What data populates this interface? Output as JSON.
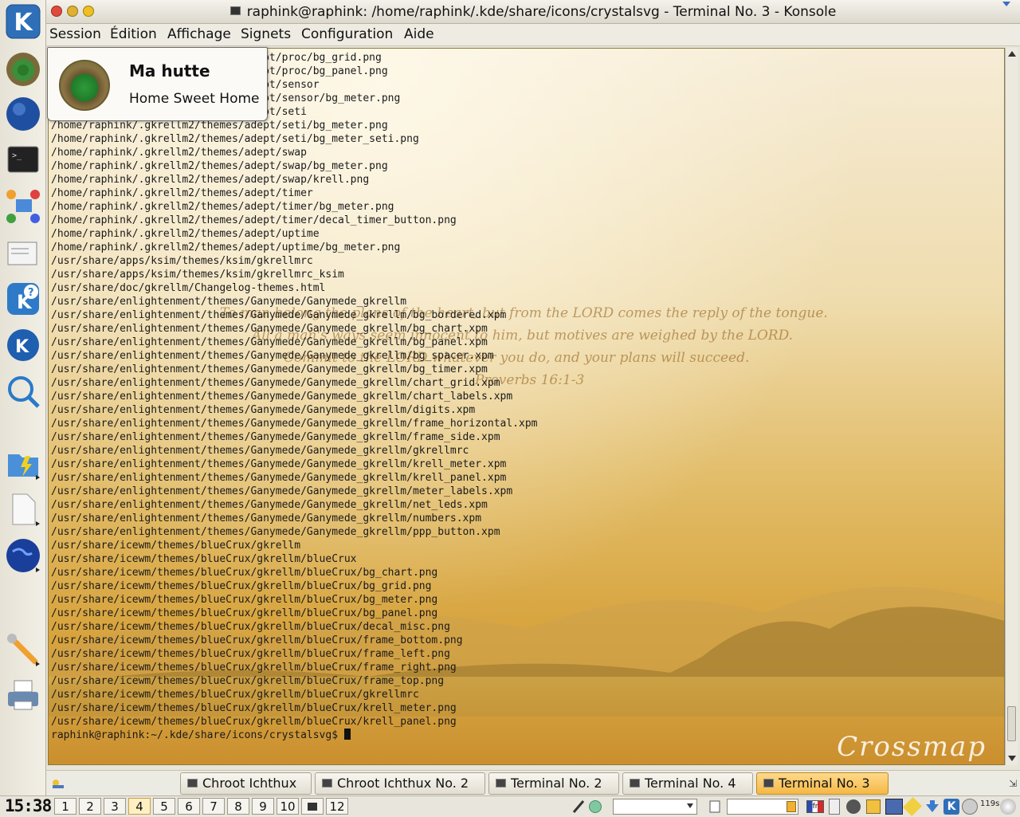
{
  "window": {
    "title": "raphink@raphink: /home/raphink/.kde/share/icons/crystalsvg - Terminal No. 3 - Konsole"
  },
  "menu": [
    "Session",
    "Édition",
    "Affichage",
    "Signets",
    "Configuration",
    "Aide"
  ],
  "tooltip": {
    "title": "Ma hutte",
    "subtitle": "Home Sweet Home"
  },
  "terminal": {
    "lines": [
      "/home/raphink/.gkrellm2/themes/adept/proc/bg_grid.png",
      "/home/raphink/.gkrellm2/themes/adept/proc/bg_panel.png",
      "/home/raphink/.gkrellm2/themes/adept/sensor",
      "/home/raphink/.gkrellm2/themes/adept/sensor/bg_meter.png",
      "/home/raphink/.gkrellm2/themes/adept/seti",
      "/home/raphink/.gkrellm2/themes/adept/seti/bg_meter.png",
      "/home/raphink/.gkrellm2/themes/adept/seti/bg_meter_seti.png",
      "/home/raphink/.gkrellm2/themes/adept/swap",
      "/home/raphink/.gkrellm2/themes/adept/swap/bg_meter.png",
      "/home/raphink/.gkrellm2/themes/adept/swap/krell.png",
      "/home/raphink/.gkrellm2/themes/adept/timer",
      "/home/raphink/.gkrellm2/themes/adept/timer/bg_meter.png",
      "/home/raphink/.gkrellm2/themes/adept/timer/decal_timer_button.png",
      "/home/raphink/.gkrellm2/themes/adept/uptime",
      "/home/raphink/.gkrellm2/themes/adept/uptime/bg_meter.png",
      "/usr/share/apps/ksim/themes/ksim/gkrellmrc",
      "/usr/share/apps/ksim/themes/ksim/gkrellmrc_ksim",
      "/usr/share/doc/gkrellm/Changelog-themes.html",
      "/usr/share/enlightenment/themes/Ganymede/Ganymede_gkrellm",
      "/usr/share/enlightenment/themes/Ganymede/Ganymede_gkrellm/bg_bordered.xpm",
      "/usr/share/enlightenment/themes/Ganymede/Ganymede_gkrellm/bg_chart.xpm",
      "/usr/share/enlightenment/themes/Ganymede/Ganymede_gkrellm/bg_panel.xpm",
      "/usr/share/enlightenment/themes/Ganymede/Ganymede_gkrellm/bg_spacer.xpm",
      "/usr/share/enlightenment/themes/Ganymede/Ganymede_gkrellm/bg_timer.xpm",
      "/usr/share/enlightenment/themes/Ganymede/Ganymede_gkrellm/chart_grid.xpm",
      "/usr/share/enlightenment/themes/Ganymede/Ganymede_gkrellm/chart_labels.xpm",
      "/usr/share/enlightenment/themes/Ganymede/Ganymede_gkrellm/digits.xpm",
      "/usr/share/enlightenment/themes/Ganymede/Ganymede_gkrellm/frame_horizontal.xpm",
      "/usr/share/enlightenment/themes/Ganymede/Ganymede_gkrellm/frame_side.xpm",
      "/usr/share/enlightenment/themes/Ganymede/Ganymede_gkrellm/gkrellmrc",
      "/usr/share/enlightenment/themes/Ganymede/Ganymede_gkrellm/krell_meter.xpm",
      "/usr/share/enlightenment/themes/Ganymede/Ganymede_gkrellm/krell_panel.xpm",
      "/usr/share/enlightenment/themes/Ganymede/Ganymede_gkrellm/meter_labels.xpm",
      "/usr/share/enlightenment/themes/Ganymede/Ganymede_gkrellm/net_leds.xpm",
      "/usr/share/enlightenment/themes/Ganymede/Ganymede_gkrellm/numbers.xpm",
      "/usr/share/enlightenment/themes/Ganymede/Ganymede_gkrellm/ppp_button.xpm",
      "/usr/share/icewm/themes/blueCrux/gkrellm",
      "/usr/share/icewm/themes/blueCrux/gkrellm/blueCrux",
      "/usr/share/icewm/themes/blueCrux/gkrellm/blueCrux/bg_chart.png",
      "/usr/share/icewm/themes/blueCrux/gkrellm/blueCrux/bg_grid.png",
      "/usr/share/icewm/themes/blueCrux/gkrellm/blueCrux/bg_meter.png",
      "/usr/share/icewm/themes/blueCrux/gkrellm/blueCrux/bg_panel.png",
      "/usr/share/icewm/themes/blueCrux/gkrellm/blueCrux/decal_misc.png",
      "/usr/share/icewm/themes/blueCrux/gkrellm/blueCrux/frame_bottom.png",
      "/usr/share/icewm/themes/blueCrux/gkrellm/blueCrux/frame_left.png",
      "/usr/share/icewm/themes/blueCrux/gkrellm/blueCrux/frame_right.png",
      "/usr/share/icewm/themes/blueCrux/gkrellm/blueCrux/frame_top.png",
      "/usr/share/icewm/themes/blueCrux/gkrellm/blueCrux/gkrellmrc",
      "/usr/share/icewm/themes/blueCrux/gkrellm/blueCrux/krell_meter.png",
      "/usr/share/icewm/themes/blueCrux/gkrellm/blueCrux/krell_panel.png"
    ],
    "prompt": "raphink@raphink:~/.kde/share/icons/crystalsvg$ ",
    "wallpaper_verse": [
      "To man belong the plans of the heart, but from the LORD comes the reply of the tongue.",
      "All a man's ways seem innocent to him, but motives are weighed by the LORD.",
      "Commit to the LORD whatever you do, and your plans will succeed.",
      "Proverbs 16:1-3"
    ],
    "wallpaper_logo": "Crossmap"
  },
  "taskbar": {
    "tasks": [
      "Chroot Ichthux",
      "Chroot Ichthux No. 2",
      "Terminal No. 2",
      "Terminal No. 4",
      "Terminal No. 3"
    ],
    "active": "Terminal No. 3"
  },
  "bottom": {
    "clock": "15:38",
    "desktops": [
      "1",
      "2",
      "3",
      "4",
      "5",
      "6",
      "7",
      "8",
      "9",
      "10",
      "",
      "12"
    ],
    "active_desktop": "4",
    "tray_text": "119s"
  },
  "left_panel_icons": [
    "home-icon",
    "browser-globe-icon",
    "terminal-icon",
    "network-icon",
    "mail-icon",
    "kde-help-icon",
    "kde-mail-icon",
    "search-globe-icon",
    "folder-quick-icon",
    "document-icon",
    "world-icon",
    "tools-icon",
    "printer-icon"
  ],
  "colors": {
    "accent": "#f5b845",
    "terminal_text": "#1a1a1a"
  }
}
